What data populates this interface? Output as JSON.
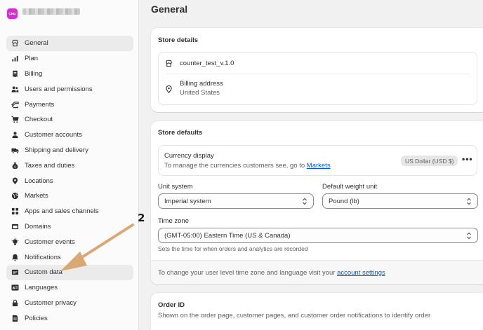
{
  "store": {
    "logo_text": "CNG"
  },
  "sidebar": {
    "items": [
      {
        "label": "General",
        "icon": "store-icon",
        "active": true
      },
      {
        "label": "Plan",
        "icon": "chart-icon"
      },
      {
        "label": "Billing",
        "icon": "receipt-icon"
      },
      {
        "label": "Users and permissions",
        "icon": "users-icon"
      },
      {
        "label": "Payments",
        "icon": "payments-icon"
      },
      {
        "label": "Checkout",
        "icon": "cart-icon"
      },
      {
        "label": "Customer accounts",
        "icon": "person-icon"
      },
      {
        "label": "Shipping and delivery",
        "icon": "truck-icon"
      },
      {
        "label": "Taxes and duties",
        "icon": "tax-icon"
      },
      {
        "label": "Locations",
        "icon": "pin-icon"
      },
      {
        "label": "Markets",
        "icon": "globe-icon"
      },
      {
        "label": "Apps and sales channels",
        "icon": "apps-icon"
      },
      {
        "label": "Domains",
        "icon": "domain-icon"
      },
      {
        "label": "Customer events",
        "icon": "events-icon"
      },
      {
        "label": "Notifications",
        "icon": "bell-icon"
      },
      {
        "label": "Custom data",
        "icon": "database-icon",
        "highlighted": true
      },
      {
        "label": "Languages",
        "icon": "language-icon"
      },
      {
        "label": "Customer privacy",
        "icon": "lock-icon"
      },
      {
        "label": "Policies",
        "icon": "policy-icon"
      }
    ]
  },
  "main": {
    "title": "General",
    "store_details": {
      "title": "Store details",
      "store_name": "counter_test_v.1.0",
      "billing_label": "Billing address",
      "billing_value": "United States"
    },
    "store_defaults": {
      "title": "Store defaults",
      "currency_label": "Currency display",
      "currency_help_prefix": "To manage the currencies customers see, go to",
      "currency_help_link": "Markets",
      "currency_badge": "US Dollar (USD $)",
      "more_label": "•••",
      "unit_system_label": "Unit system",
      "unit_system_value": "Imperial system",
      "weight_unit_label": "Default weight unit",
      "weight_unit_value": "Pound (lb)",
      "timezone_label": "Time zone",
      "timezone_value": "(GMT-05:00) Eastern Time (US & Canada)",
      "timezone_help": "Sets the time for when orders and analytics are recorded",
      "footer_prefix": "To change your user level time zone and language visit your",
      "footer_link": "account settings"
    },
    "order_id": {
      "title": "Order ID",
      "description": "Shown on the order page, customer pages, and customer order notifications to identify order"
    }
  },
  "annotation": {
    "step_number": "2",
    "arrow_color": "#d9a877"
  }
}
